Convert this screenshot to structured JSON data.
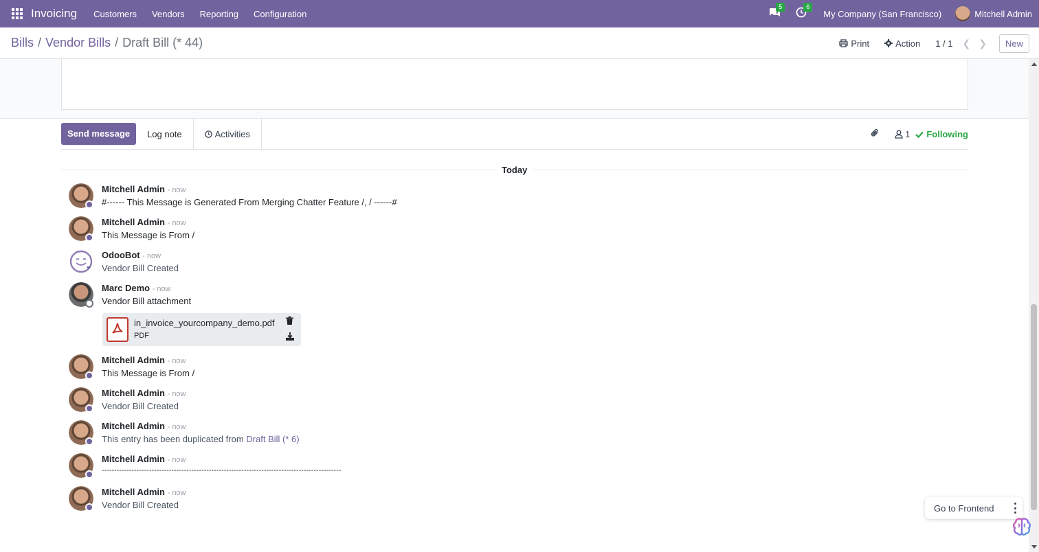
{
  "navbar": {
    "app_title": "Invoicing",
    "menu": [
      "Customers",
      "Vendors",
      "Reporting",
      "Configuration"
    ],
    "messages_count": "5",
    "activities_count": "6",
    "company": "My Company (San Francisco)",
    "user": "Mitchell Admin",
    "accent_color": "#71639e"
  },
  "breadcrumb": {
    "items": [
      "Bills",
      "Vendor Bills"
    ],
    "current": "Draft Bill (* 44)",
    "separator": "/"
  },
  "control_panel": {
    "print_label": "Print",
    "action_label": "Action",
    "pager": "1 / 1",
    "new_label": "New"
  },
  "chatter": {
    "send_message_label": "Send message",
    "log_note_label": "Log note",
    "activities_label": "Activities",
    "followers_count": "1",
    "following_label": "Following",
    "today_label": "Today"
  },
  "messages": [
    {
      "author": "Mitchell Admin",
      "date": "- now",
      "body": "#------ This Message is Generated From Merging Chatter Feature /, / ------#"
    },
    {
      "author": "Mitchell Admin",
      "date": "- now",
      "body": "This Message is From /"
    },
    {
      "author": "OdooBot",
      "date": "- now",
      "body": "Vendor Bill Created"
    },
    {
      "author": "Marc Demo",
      "date": "- now",
      "body": "Vendor Bill attachment"
    },
    {
      "author": "Mitchell Admin",
      "date": "- now",
      "body": "This Message is From /"
    },
    {
      "author": "Mitchell Admin",
      "date": "- now",
      "body": "Vendor Bill Created"
    },
    {
      "author": "Mitchell Admin",
      "date": "- now",
      "body": "This entry has been duplicated from ",
      "link": "Draft Bill (* 6)"
    },
    {
      "author": "Mitchell Admin",
      "date": "- now",
      "body": "------------------------------------------------------------------------------------------------"
    },
    {
      "author": "Mitchell Admin",
      "date": "- now",
      "body": "Vendor Bill Created"
    }
  ],
  "attachment": {
    "name": "in_invoice_yourcompany_demo.pdf",
    "type": "PDF"
  },
  "floating": {
    "frontend_label": "Go to Frontend"
  }
}
